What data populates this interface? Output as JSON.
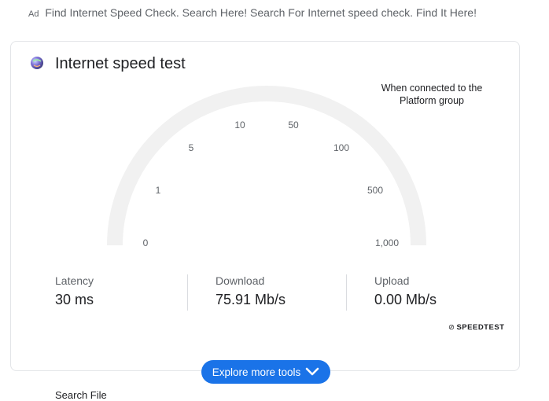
{
  "ad": {
    "tag": "Ad",
    "text": "Find Internet Speed Check. Search Here! Search For Internet speed check. Find It Here!"
  },
  "card": {
    "title": "Internet speed test",
    "note": "When connected to the Platform group",
    "gauge": {
      "ticks": [
        "0",
        "1",
        "5",
        "10",
        "50",
        "100",
        "500",
        "1,000"
      ]
    },
    "stats": {
      "latency": {
        "label": "Latency",
        "value": "30 ms"
      },
      "download": {
        "label": "Download",
        "value": "75.91 Mb/s"
      },
      "upload": {
        "label": "Upload",
        "value": "0.00 Mb/s"
      }
    },
    "brand": {
      "glyph": "⊘",
      "text": "SPEEDTEST"
    }
  },
  "explore": {
    "label": "Explore more tools"
  },
  "peek_text": "Search File",
  "colors": {
    "accent": "#1a73e8",
    "track": "#f1f1f1",
    "card_border": "#e3e5e8"
  }
}
